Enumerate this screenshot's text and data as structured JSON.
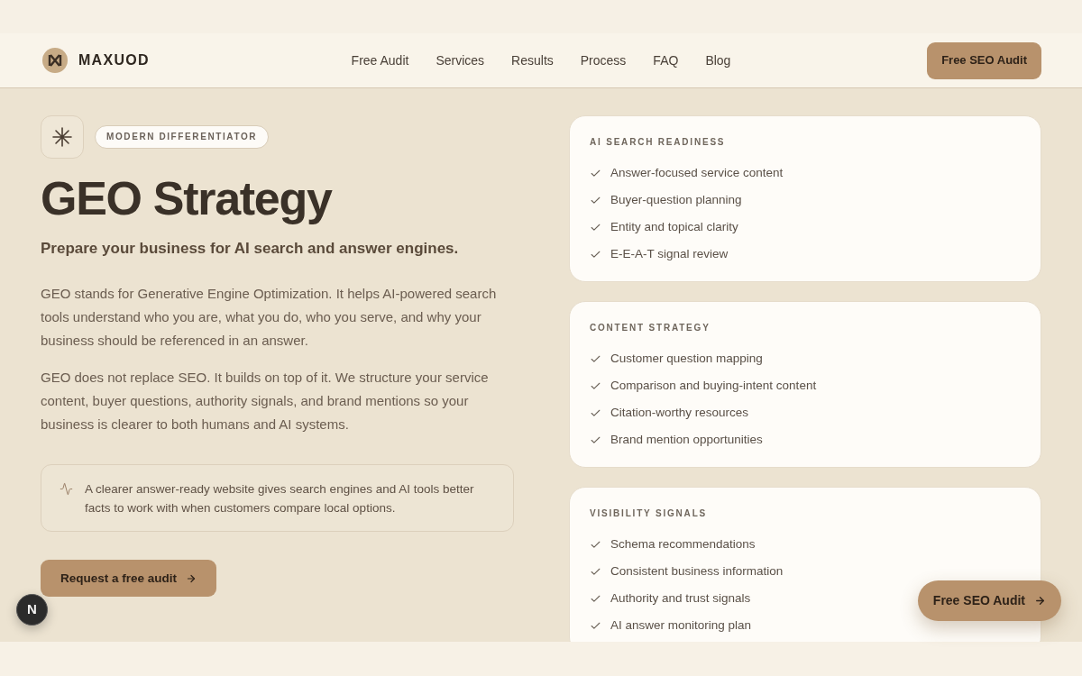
{
  "header": {
    "brand": "MAXUOD",
    "nav": [
      {
        "label": "Free Audit"
      },
      {
        "label": "Services"
      },
      {
        "label": "Results"
      },
      {
        "label": "Process"
      },
      {
        "label": "FAQ"
      },
      {
        "label": "Blog"
      }
    ],
    "cta": {
      "label": "Free SEO Audit"
    }
  },
  "hero": {
    "badge": "MODERN DIFFERENTIATOR",
    "title": "GEO Strategy",
    "subtitle": "Prepare your business for AI search and answer engines.",
    "paragraphs": [
      "GEO stands for Generative Engine Optimization. It helps AI-powered search tools understand who you are, what you do, who you serve, and why your business should be referenced in an answer.",
      "GEO does not replace SEO. It builds on top of it. We structure your service content, buyer questions, authority signals, and brand mentions so your business is clearer to both humans and AI systems."
    ],
    "callout": "A clearer answer-ready website gives search engines and AI tools better facts to work with when customers compare local options.",
    "button": {
      "label": "Request a free audit"
    }
  },
  "cards": [
    {
      "title": "AI SEARCH READINESS",
      "items": [
        "Answer-focused service content",
        "Buyer-question planning",
        "Entity and topical clarity",
        "E-E-A-T signal review"
      ]
    },
    {
      "title": "CONTENT STRATEGY",
      "items": [
        "Customer question mapping",
        "Comparison and buying-intent content",
        "Citation-worthy resources",
        "Brand mention opportunities"
      ]
    },
    {
      "title": "VISIBILITY SIGNALS",
      "items": [
        "Schema recommendations",
        "Consistent business information",
        "Authority and trust signals",
        "AI answer monitoring plan"
      ]
    }
  ],
  "floating_button": {
    "label": "Free SEO Audit"
  },
  "dev_indicator": {
    "label": "N"
  }
}
